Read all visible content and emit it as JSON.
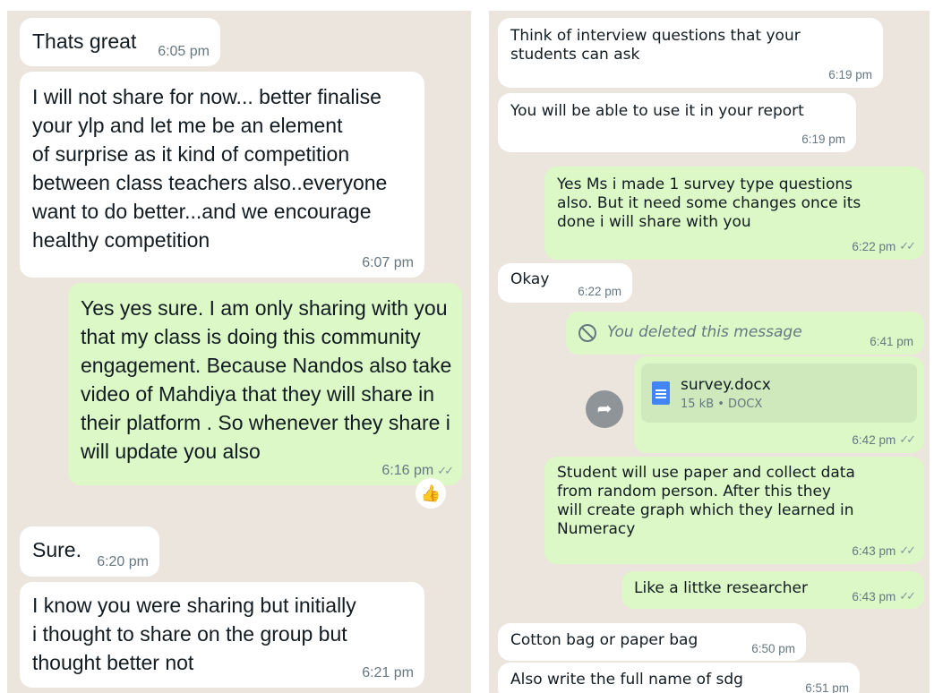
{
  "left": {
    "messages": [
      {
        "text": "Thats great",
        "time": "6:05 pm"
      },
      {
        "text": "I will not share for now... better finalise\nyour ylp and let me be an element\nof surprise as it kind of competition\nbetween class teachers also..everyone\nwant to do better...and we encourage\nhealthy competition",
        "time": "6:07 pm"
      },
      {
        "text": "Yes yes sure. I am only sharing with you\nthat my class is doing this community\nengagement.  Because Nandos also take\nvideo of Mahdiya that they will share in\ntheir platform . So whenever they share i\nwill update you also",
        "time": "6:16 pm",
        "status": "read"
      },
      {
        "text": "Sure.",
        "time": "6:20 pm"
      },
      {
        "text": "I know you were sharing but initially\ni thought to share on the group but\nthought better not",
        "time": "6:21 pm"
      }
    ],
    "reaction": {
      "icon": "thumbs-up-icon",
      "glyph": "👍"
    }
  },
  "right": {
    "messages": [
      {
        "text": "Think of interview questions that your\nstudents can ask",
        "time": "6:19 pm"
      },
      {
        "text": "You will be able to use it in your report",
        "time": "6:19 pm"
      },
      {
        "text": "Yes Ms i made 1 survey type questions\nalso. But it need some changes once its\ndone i will share with you",
        "time": "6:22 pm",
        "status": "read"
      },
      {
        "text": "Okay",
        "time": "6:22 pm"
      },
      {
        "text": "You deleted this message",
        "time": "6:41 pm",
        "deleted": true
      },
      {
        "file_name": "survey.docx",
        "file_info": "15 kB • DOCX",
        "time": "6:42 pm",
        "status": "read"
      },
      {
        "text": "Student will use paper and collect data\nfrom random person. After this they\nwill create graph which they learned in\nNumeracy",
        "time": "6:43 pm",
        "status": "read"
      },
      {
        "text": "Like a littke researcher",
        "time": "6:43 pm",
        "status": "read"
      },
      {
        "text": "Cotton bag or paper bag",
        "time": "6:50 pm"
      },
      {
        "text": "Also write the full name of sdg",
        "time": "6:51 pm"
      }
    ],
    "forward_icon": {
      "name": "forward-icon",
      "glyph": "➦"
    },
    "deleted_icon": "blocked-icon",
    "file_icon": "docx-file-icon"
  },
  "colors": {
    "wallpaper": "#ece5dd",
    "incoming_bubble": "#ffffff",
    "outgoing_bubble": "#dcf8c6",
    "timestamp": "#667781",
    "read_ticks": "#8696a0"
  },
  "status_glyph": "✓✓"
}
